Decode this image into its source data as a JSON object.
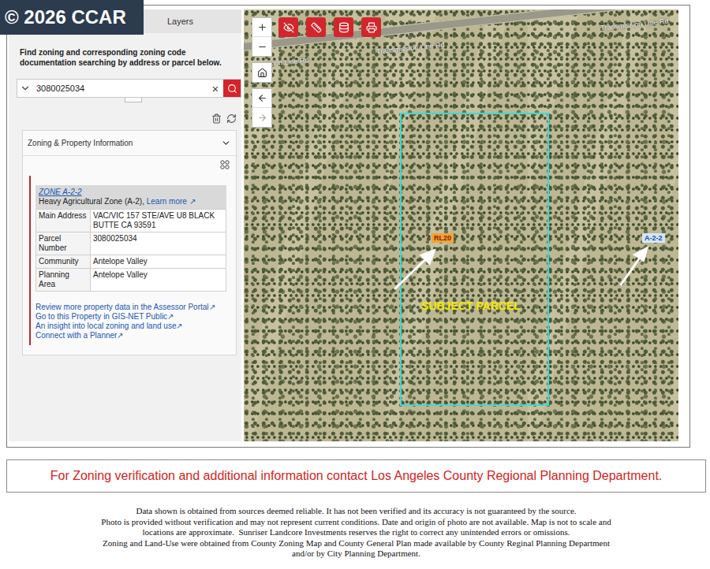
{
  "watermark": "© 2026 CCAR",
  "panel": {
    "title": "Layers",
    "instructions": "Find zoning and corresponding zoning code documentation searching by address or parcel below.",
    "search": {
      "value": "3080025034",
      "clear": "×"
    }
  },
  "zoning_card": {
    "title": "Zoning & Property Information",
    "expanded": true,
    "zone_code": "ZONE A-2-2",
    "zone_name": "Heavy Agricultural Zone (A-2),",
    "learn_more": "Learn more ↗",
    "rows": [
      {
        "label": "Main Address",
        "value": "VAC/VIC 157 STE/AVE U8 BLACK BUTTE CA 93591"
      },
      {
        "label": "Parcel Number",
        "value": "3080025034"
      },
      {
        "label": "Community",
        "value": "Antelope Valley"
      },
      {
        "label": "Planning Area",
        "value": "Antelope Valley"
      }
    ],
    "links": [
      "Review more property data in the Assessor Portal↗",
      "Go to this Property in GIS-NET Public↗",
      "An insight into local zoning and land use↗",
      "Connect with a Planner↗"
    ]
  },
  "map": {
    "road_labels": [
      "ission Line Rd",
      "Transmission Line Rd",
      "Transmission Line Rd"
    ],
    "zone_labels": [
      {
        "text": "RL20",
        "color": "#f2a33a"
      },
      {
        "text": "A-2-2",
        "color": "#d3e6f8"
      }
    ],
    "parcel_label": "SUBJECT PARCEL"
  },
  "notice": "For Zoning verification and additional information contact Los Angeles County Regional Planning Department.",
  "disclaimer": [
    "Data shown is obtained from sources deemed reliable. It has not been verified and its accuracy is not guaranteed by the source.",
    "Photo is provided without verification and may not represent current conditions. Date and origin of photo are not available. Map is not to scale and",
    "locations are approximate.  Sunriser Landcore Investments reserves the right to correct any unintended errors or omissions.",
    "Zoning and Land-Use were obtained from County Zoning Map and County General Plan made available by County Reginal Planning Department",
    "and/or by City Planning Department."
  ]
}
